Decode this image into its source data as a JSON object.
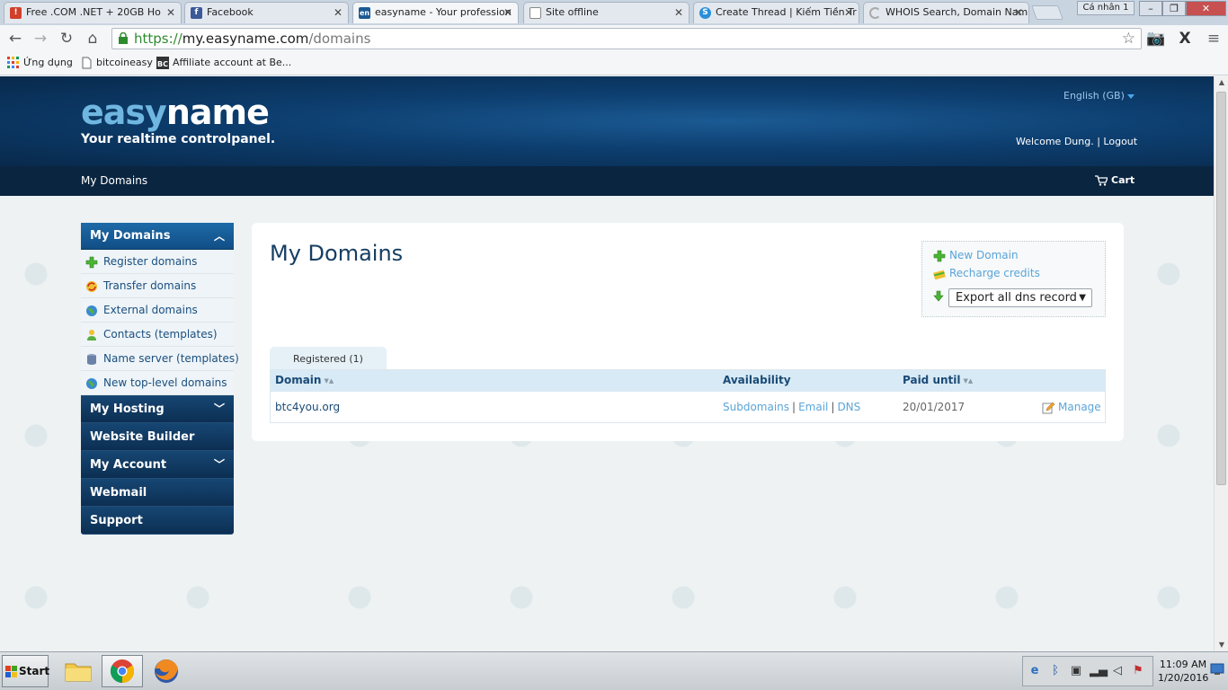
{
  "browser": {
    "tabs": [
      {
        "title": "Free .COM .NET + 20GB Ho",
        "color": "#d0402a"
      },
      {
        "title": "Facebook",
        "color": "#3b5998"
      },
      {
        "title": "easyname - Your profession",
        "color": "#1b5a93"
      },
      {
        "title": "Site offline",
        "color": "#888888"
      },
      {
        "title": "Create Thread | Kiếm Tiền Tr",
        "color": "#2a8fd8"
      },
      {
        "title": "WHOIS Search, Domain Nam",
        "color": "#aaaaaa"
      }
    ],
    "profile_label": "Cá nhân 1",
    "url_scheme": "https://",
    "url_host": "my.easyname.com",
    "url_path": "/domains",
    "bookmarks": [
      {
        "label": "Ứng dụng",
        "icon": "apps-grid-icon"
      },
      {
        "label": "bitcoineasy",
        "icon": "page-icon"
      },
      {
        "label": "Affiliate account at Be...",
        "icon": "bc-logo-icon"
      }
    ]
  },
  "header": {
    "logo_easy": "easy",
    "logo_name": "name",
    "tagline": "Your realtime controlpanel.",
    "language": "English (GB)",
    "welcome": "Welcome Dung.",
    "logout": "Logout"
  },
  "subnav": {
    "crumb": "My Domains",
    "cart": "Cart"
  },
  "sidebar": {
    "domains_header": "My Domains",
    "domain_items": [
      {
        "label": "Register domains",
        "icon": "plus-icon"
      },
      {
        "label": "Transfer domains",
        "icon": "transfer-icon"
      },
      {
        "label": "External domains",
        "icon": "globe-icon"
      },
      {
        "label": "Contacts (templates)",
        "icon": "contact-icon"
      },
      {
        "label": "Name server (templates)",
        "icon": "server-icon"
      },
      {
        "label": "New top-level domains",
        "icon": "globe-icon"
      }
    ],
    "sections": [
      {
        "label": "My Hosting",
        "expandable": true
      },
      {
        "label": "Website Builder",
        "expandable": false
      },
      {
        "label": "My Account",
        "expandable": true
      },
      {
        "label": "Webmail",
        "expandable": false
      },
      {
        "label": "Support",
        "expandable": false
      }
    ]
  },
  "main": {
    "title": "My Domains",
    "actions": {
      "new_domain": "New Domain",
      "recharge": "Recharge credits",
      "export_selected": "Export all dns records"
    },
    "tab_label": "Registered (1)",
    "columns": {
      "domain": "Domain",
      "availability": "Availability",
      "paid_until": "Paid until"
    },
    "rows": [
      {
        "domain": "btc4you.org",
        "links": [
          "Subdomains",
          "Email",
          "DNS"
        ],
        "paid_until": "20/01/2017",
        "manage": "Manage"
      }
    ]
  },
  "taskbar": {
    "start": "Start",
    "time": "11:09 AM",
    "date": "1/20/2016"
  }
}
